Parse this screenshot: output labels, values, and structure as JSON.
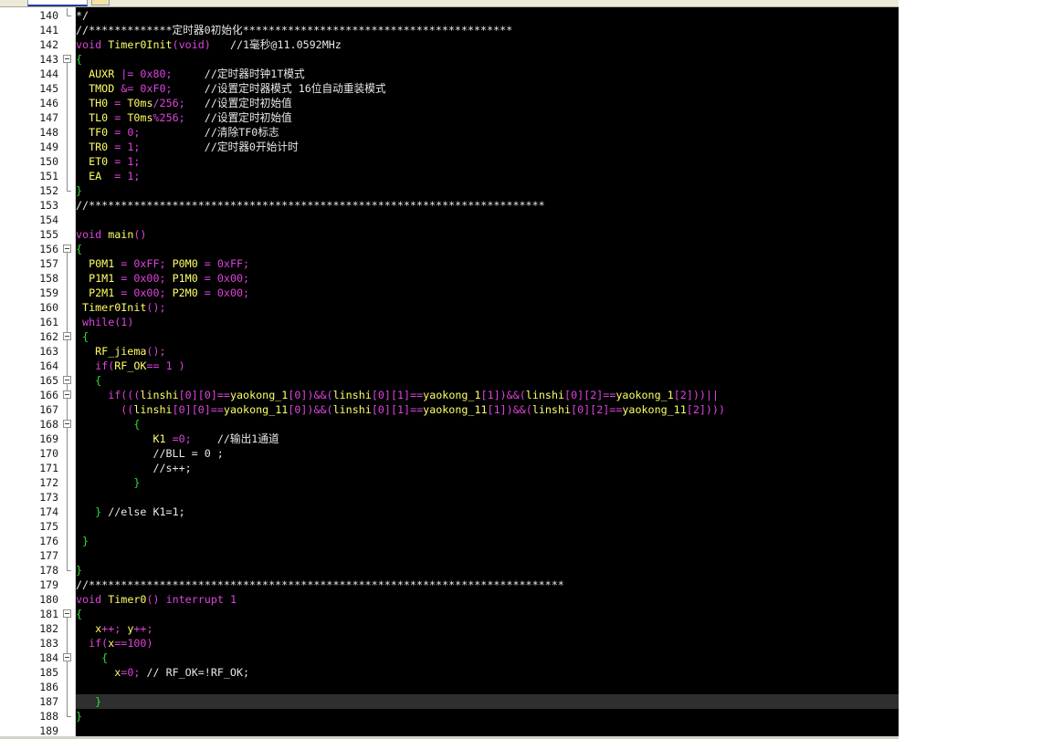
{
  "editor": {
    "lines": [
      {
        "n": "140",
        "fold": "end",
        "tokens": [
          [
            "*/",
            "t-cmt"
          ]
        ]
      },
      {
        "n": "141",
        "fold": "none",
        "tokens": [
          [
            "//*************定时器0初始化******************************************",
            "t-cmt"
          ]
        ]
      },
      {
        "n": "142",
        "fold": "none",
        "tokens": [
          [
            "void",
            "t-kw"
          ],
          [
            " ",
            "t-plain"
          ],
          [
            "Timer0Init",
            "t-func"
          ],
          [
            "(",
            "t-op"
          ],
          [
            "void",
            "t-kw"
          ],
          [
            ")",
            "t-op"
          ],
          [
            "   //1毫秒@11.0592MHz",
            "t-cmt"
          ]
        ]
      },
      {
        "n": "143",
        "fold": "open",
        "tokens": [
          [
            "{",
            "t-brace"
          ]
        ]
      },
      {
        "n": "144",
        "fold": "line",
        "tokens": [
          [
            "  ",
            "t-plain"
          ],
          [
            "AUXR",
            "t-id"
          ],
          [
            " |= ",
            "t-op"
          ],
          [
            "0x80",
            "t-num"
          ],
          [
            ";",
            "t-op"
          ],
          [
            "     //定时器时钟1T模式",
            "t-cmt"
          ]
        ]
      },
      {
        "n": "145",
        "fold": "line",
        "tokens": [
          [
            "  ",
            "t-plain"
          ],
          [
            "TMOD",
            "t-id"
          ],
          [
            " &= ",
            "t-op"
          ],
          [
            "0xF0",
            "t-num"
          ],
          [
            ";",
            "t-op"
          ],
          [
            "     //设置定时器模式 16位自动重装模式",
            "t-cmt"
          ]
        ]
      },
      {
        "n": "146",
        "fold": "line",
        "tokens": [
          [
            "  ",
            "t-plain"
          ],
          [
            "TH0",
            "t-id"
          ],
          [
            " = ",
            "t-op"
          ],
          [
            "T0ms",
            "t-id"
          ],
          [
            "/",
            "t-op"
          ],
          [
            "256",
            "t-num"
          ],
          [
            ";",
            "t-op"
          ],
          [
            "   //设置定时初始值",
            "t-cmt"
          ]
        ]
      },
      {
        "n": "147",
        "fold": "line",
        "tokens": [
          [
            "  ",
            "t-plain"
          ],
          [
            "TL0",
            "t-id"
          ],
          [
            " = ",
            "t-op"
          ],
          [
            "T0ms",
            "t-id"
          ],
          [
            "%",
            "t-op"
          ],
          [
            "256",
            "t-num"
          ],
          [
            ";",
            "t-op"
          ],
          [
            "   //设置定时初始值",
            "t-cmt"
          ]
        ]
      },
      {
        "n": "148",
        "fold": "line",
        "tokens": [
          [
            "  ",
            "t-plain"
          ],
          [
            "TF0",
            "t-id"
          ],
          [
            " = ",
            "t-op"
          ],
          [
            "0",
            "t-num"
          ],
          [
            ";",
            "t-op"
          ],
          [
            "          //清除TF0标志",
            "t-cmt"
          ]
        ]
      },
      {
        "n": "149",
        "fold": "line",
        "tokens": [
          [
            "  ",
            "t-plain"
          ],
          [
            "TR0",
            "t-id"
          ],
          [
            " = ",
            "t-op"
          ],
          [
            "1",
            "t-num"
          ],
          [
            ";",
            "t-op"
          ],
          [
            "          //定时器0开始计时",
            "t-cmt"
          ]
        ]
      },
      {
        "n": "150",
        "fold": "line",
        "tokens": [
          [
            "  ",
            "t-plain"
          ],
          [
            "ET0",
            "t-id"
          ],
          [
            " = ",
            "t-op"
          ],
          [
            "1",
            "t-num"
          ],
          [
            ";",
            "t-op"
          ]
        ]
      },
      {
        "n": "151",
        "fold": "line",
        "tokens": [
          [
            "  ",
            "t-plain"
          ],
          [
            "EA",
            "t-id"
          ],
          [
            "  = ",
            "t-op"
          ],
          [
            "1",
            "t-num"
          ],
          [
            ";",
            "t-op"
          ]
        ]
      },
      {
        "n": "152",
        "fold": "end",
        "tokens": [
          [
            "}",
            "t-brace"
          ]
        ]
      },
      {
        "n": "153",
        "fold": "none",
        "tokens": [
          [
            "//***********************************************************************",
            "t-cmt"
          ]
        ]
      },
      {
        "n": "154",
        "fold": "none",
        "tokens": []
      },
      {
        "n": "155",
        "fold": "none",
        "tokens": [
          [
            "void",
            "t-kw"
          ],
          [
            " ",
            "t-plain"
          ],
          [
            "main",
            "t-func"
          ],
          [
            "()",
            "t-op"
          ]
        ]
      },
      {
        "n": "156",
        "fold": "open",
        "tokens": [
          [
            "{",
            "t-brace"
          ]
        ]
      },
      {
        "n": "157",
        "fold": "line",
        "tokens": [
          [
            "  ",
            "t-plain"
          ],
          [
            "P0M1",
            "t-id"
          ],
          [
            " = ",
            "t-op"
          ],
          [
            "0xFF",
            "t-num"
          ],
          [
            "; ",
            "t-op"
          ],
          [
            "P0M0",
            "t-id"
          ],
          [
            " = ",
            "t-op"
          ],
          [
            "0xFF",
            "t-num"
          ],
          [
            ";",
            "t-op"
          ]
        ]
      },
      {
        "n": "158",
        "fold": "line",
        "tokens": [
          [
            "  ",
            "t-plain"
          ],
          [
            "P1M1",
            "t-id"
          ],
          [
            " = ",
            "t-op"
          ],
          [
            "0x00",
            "t-num"
          ],
          [
            "; ",
            "t-op"
          ],
          [
            "P1M0",
            "t-id"
          ],
          [
            " = ",
            "t-op"
          ],
          [
            "0x00",
            "t-num"
          ],
          [
            ";",
            "t-op"
          ]
        ]
      },
      {
        "n": "159",
        "fold": "line",
        "tokens": [
          [
            "  ",
            "t-plain"
          ],
          [
            "P2M1",
            "t-id"
          ],
          [
            " = ",
            "t-op"
          ],
          [
            "0x00",
            "t-num"
          ],
          [
            "; ",
            "t-op"
          ],
          [
            "P2M0",
            "t-id"
          ],
          [
            " = ",
            "t-op"
          ],
          [
            "0x00",
            "t-num"
          ],
          [
            ";",
            "t-op"
          ]
        ]
      },
      {
        "n": "160",
        "fold": "line",
        "tokens": [
          [
            " ",
            "t-plain"
          ],
          [
            "Timer0Init",
            "t-func"
          ],
          [
            "();",
            "t-op"
          ]
        ]
      },
      {
        "n": "161",
        "fold": "line",
        "tokens": [
          [
            " ",
            "t-plain"
          ],
          [
            "while",
            "t-kw"
          ],
          [
            "(",
            "t-op"
          ],
          [
            "1",
            "t-num"
          ],
          [
            ")",
            "t-op"
          ]
        ]
      },
      {
        "n": "162",
        "fold": "open",
        "tokens": [
          [
            " ",
            "t-plain"
          ],
          [
            "{",
            "t-brace"
          ]
        ]
      },
      {
        "n": "163",
        "fold": "line",
        "tokens": [
          [
            "   ",
            "t-plain"
          ],
          [
            "RF_jiema",
            "t-func"
          ],
          [
            "();",
            "t-op"
          ]
        ]
      },
      {
        "n": "164",
        "fold": "line",
        "tokens": [
          [
            "   ",
            "t-plain"
          ],
          [
            "if",
            "t-kw"
          ],
          [
            "(",
            "t-op"
          ],
          [
            "RF_OK",
            "t-id"
          ],
          [
            "== ",
            "t-op"
          ],
          [
            "1",
            "t-num"
          ],
          [
            " )",
            "t-op"
          ]
        ]
      },
      {
        "n": "165",
        "fold": "open",
        "tokens": [
          [
            "   ",
            "t-plain"
          ],
          [
            "{",
            "t-brace"
          ]
        ]
      },
      {
        "n": "166",
        "fold": "open",
        "tokens": [
          [
            "     ",
            "t-plain"
          ],
          [
            "if",
            "t-kw"
          ],
          [
            "(((",
            "t-op"
          ],
          [
            "linshi",
            "t-id"
          ],
          [
            "[",
            "t-op"
          ],
          [
            "0",
            "t-num"
          ],
          [
            "][",
            "t-op"
          ],
          [
            "0",
            "t-num"
          ],
          [
            "]==",
            "t-op"
          ],
          [
            "yaokong_1",
            "t-id"
          ],
          [
            "[",
            "t-op"
          ],
          [
            "0",
            "t-num"
          ],
          [
            "])&&(",
            "t-op"
          ],
          [
            "linshi",
            "t-id"
          ],
          [
            "[",
            "t-op"
          ],
          [
            "0",
            "t-num"
          ],
          [
            "][",
            "t-op"
          ],
          [
            "1",
            "t-num"
          ],
          [
            "]==",
            "t-op"
          ],
          [
            "yaokong_1",
            "t-id"
          ],
          [
            "[",
            "t-op"
          ],
          [
            "1",
            "t-num"
          ],
          [
            "])&&(",
            "t-op"
          ],
          [
            "linshi",
            "t-id"
          ],
          [
            "[",
            "t-op"
          ],
          [
            "0",
            "t-num"
          ],
          [
            "][",
            "t-op"
          ],
          [
            "2",
            "t-num"
          ],
          [
            "]==",
            "t-op"
          ],
          [
            "yaokong_1",
            "t-id"
          ],
          [
            "[",
            "t-op"
          ],
          [
            "2",
            "t-num"
          ],
          [
            "]))||",
            "t-op"
          ]
        ]
      },
      {
        "n": "167",
        "fold": "line",
        "tokens": [
          [
            "       ",
            "t-plain"
          ],
          [
            "((",
            "t-op"
          ],
          [
            "linshi",
            "t-id"
          ],
          [
            "[",
            "t-op"
          ],
          [
            "0",
            "t-num"
          ],
          [
            "][",
            "t-op"
          ],
          [
            "0",
            "t-num"
          ],
          [
            "]==",
            "t-op"
          ],
          [
            "yaokong_11",
            "t-id"
          ],
          [
            "[",
            "t-op"
          ],
          [
            "0",
            "t-num"
          ],
          [
            "])&&(",
            "t-op"
          ],
          [
            "linshi",
            "t-id"
          ],
          [
            "[",
            "t-op"
          ],
          [
            "0",
            "t-num"
          ],
          [
            "][",
            "t-op"
          ],
          [
            "1",
            "t-num"
          ],
          [
            "]==",
            "t-op"
          ],
          [
            "yaokong_11",
            "t-id"
          ],
          [
            "[",
            "t-op"
          ],
          [
            "1",
            "t-num"
          ],
          [
            "])&&(",
            "t-op"
          ],
          [
            "linshi",
            "t-id"
          ],
          [
            "[",
            "t-op"
          ],
          [
            "0",
            "t-num"
          ],
          [
            "][",
            "t-op"
          ],
          [
            "2",
            "t-num"
          ],
          [
            "]==",
            "t-op"
          ],
          [
            "yaokong_11",
            "t-id"
          ],
          [
            "[",
            "t-op"
          ],
          [
            "2",
            "t-num"
          ],
          [
            "])))",
            "t-op"
          ]
        ]
      },
      {
        "n": "168",
        "fold": "open",
        "tokens": [
          [
            "         ",
            "t-plain"
          ],
          [
            "{",
            "t-brace"
          ]
        ]
      },
      {
        "n": "169",
        "fold": "line",
        "tokens": [
          [
            "            ",
            "t-plain"
          ],
          [
            "K1",
            "t-id"
          ],
          [
            " =",
            "t-op"
          ],
          [
            "0",
            "t-num"
          ],
          [
            ";",
            "t-op"
          ],
          [
            "    //输出1通道",
            "t-cmt"
          ]
        ]
      },
      {
        "n": "170",
        "fold": "line",
        "tokens": [
          [
            "            //BLL = 0 ;",
            "t-cmt"
          ]
        ]
      },
      {
        "n": "171",
        "fold": "line",
        "tokens": [
          [
            "            //s++;",
            "t-cmt"
          ]
        ]
      },
      {
        "n": "172",
        "fold": "line",
        "tokens": [
          [
            "         ",
            "t-plain"
          ],
          [
            "}",
            "t-brace"
          ]
        ]
      },
      {
        "n": "173",
        "fold": "line",
        "tokens": []
      },
      {
        "n": "174",
        "fold": "line",
        "tokens": [
          [
            "   ",
            "t-plain"
          ],
          [
            "}",
            "t-brace"
          ],
          [
            " //else K1=1;",
            "t-cmt"
          ]
        ]
      },
      {
        "n": "175",
        "fold": "line",
        "tokens": []
      },
      {
        "n": "176",
        "fold": "line",
        "tokens": [
          [
            " ",
            "t-plain"
          ],
          [
            "}",
            "t-brace"
          ]
        ]
      },
      {
        "n": "177",
        "fold": "line",
        "tokens": []
      },
      {
        "n": "178",
        "fold": "end",
        "tokens": [
          [
            "}",
            "t-brace"
          ]
        ]
      },
      {
        "n": "179",
        "fold": "none",
        "tokens": [
          [
            "//**************************************************************************",
            "t-cmt"
          ]
        ]
      },
      {
        "n": "180",
        "fold": "none",
        "tokens": [
          [
            "void",
            "t-kw"
          ],
          [
            " ",
            "t-plain"
          ],
          [
            "Timer0",
            "t-func"
          ],
          [
            "() ",
            "t-op"
          ],
          [
            "interrupt",
            "t-kw"
          ],
          [
            " ",
            "t-plain"
          ],
          [
            "1",
            "t-num"
          ]
        ]
      },
      {
        "n": "181",
        "fold": "open",
        "tokens": [
          [
            "{",
            "t-brace"
          ]
        ]
      },
      {
        "n": "182",
        "fold": "line",
        "tokens": [
          [
            "   ",
            "t-plain"
          ],
          [
            "x",
            "t-id"
          ],
          [
            "++; ",
            "t-op"
          ],
          [
            "y",
            "t-id"
          ],
          [
            "++;",
            "t-op"
          ]
        ]
      },
      {
        "n": "183",
        "fold": "line",
        "tokens": [
          [
            "  ",
            "t-plain"
          ],
          [
            "if",
            "t-kw"
          ],
          [
            "(",
            "t-op"
          ],
          [
            "x",
            "t-id"
          ],
          [
            "==",
            "t-op"
          ],
          [
            "100",
            "t-num"
          ],
          [
            ")",
            "t-op"
          ]
        ]
      },
      {
        "n": "184",
        "fold": "open",
        "tokens": [
          [
            "    ",
            "t-plain"
          ],
          [
            "{",
            "t-brace"
          ]
        ]
      },
      {
        "n": "185",
        "fold": "line",
        "tokens": [
          [
            "      ",
            "t-plain"
          ],
          [
            "x",
            "t-id"
          ],
          [
            "=",
            "t-op"
          ],
          [
            "0",
            "t-num"
          ],
          [
            ";",
            "t-op"
          ],
          [
            " // RF_OK=!RF_OK;",
            "t-cmt"
          ]
        ]
      },
      {
        "n": "186",
        "fold": "line",
        "tokens": []
      },
      {
        "n": "187",
        "fold": "line",
        "current": true,
        "tokens": [
          [
            "   ",
            "t-plain"
          ],
          [
            "}",
            "t-brace"
          ]
        ]
      },
      {
        "n": "188",
        "fold": "end",
        "tokens": [
          [
            "}",
            "t-brace"
          ]
        ]
      },
      {
        "n": "189",
        "fold": "none",
        "tokens": []
      }
    ]
  }
}
